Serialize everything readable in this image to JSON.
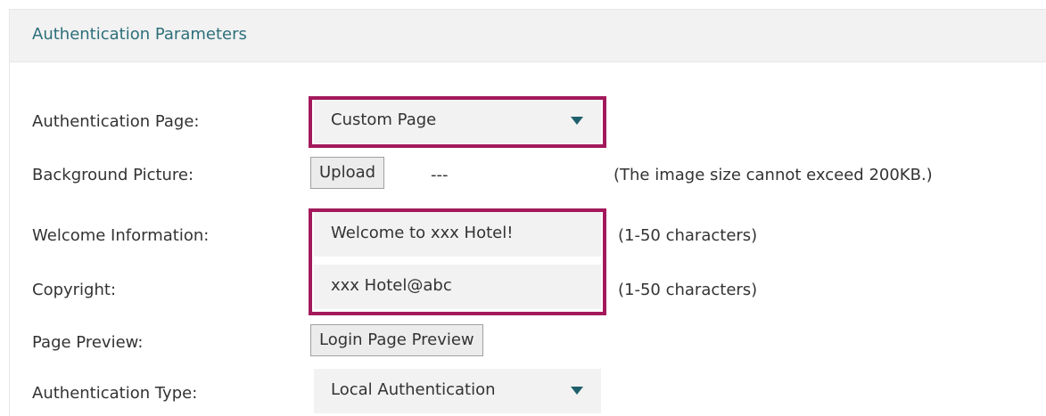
{
  "section": {
    "title": "Authentication Parameters"
  },
  "fields": {
    "auth_page": {
      "label": "Authentication Page:",
      "value": "Custom Page"
    },
    "background": {
      "label": "Background Picture:",
      "button": "Upload",
      "value": "---",
      "hint": "(The image size cannot exceed 200KB.)"
    },
    "welcome": {
      "label": "Welcome Information:",
      "value": "Welcome to xxx Hotel!",
      "hint": "(1-50 characters)"
    },
    "copyright": {
      "label": "Copyright:",
      "value": "xxx Hotel@abc",
      "hint": "(1-50 characters)"
    },
    "preview": {
      "label": "Page Preview:",
      "button": "Login Page Preview"
    },
    "auth_type": {
      "label": "Authentication Type:",
      "value": "Local Authentication"
    }
  },
  "colors": {
    "highlight": "#a3195b",
    "title": "#2d6f7a",
    "caret": "#1f5f6b"
  }
}
